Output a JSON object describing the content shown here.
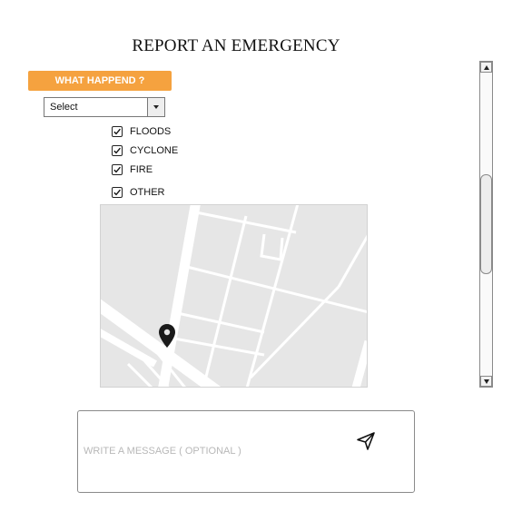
{
  "page": {
    "title": "REPORT AN EMERGENCY"
  },
  "form": {
    "what_happened_label": "WHAT HAPPEND ?",
    "select": {
      "value": "Select"
    },
    "options": [
      {
        "label": "FLOODS",
        "checked": true
      },
      {
        "label": "CYCLONE",
        "checked": true
      },
      {
        "label": "FIRE",
        "checked": true
      },
      {
        "label": "OTHER",
        "checked": true
      }
    ]
  },
  "message": {
    "placeholder": "WRITE A MESSAGE ( OPTIONAL )"
  },
  "icons": {
    "dropdown": "chevron-down-icon",
    "checkbox": "checkbox-checked-icon",
    "map_pin": "map-pin-icon",
    "send": "send-icon",
    "scroll_up": "scroll-up-arrow-icon",
    "scroll_down": "scroll-down-arrow-icon"
  },
  "colors": {
    "accent": "#f5a23f",
    "map_bg": "#e6e6e6",
    "road": "#ffffff",
    "pin": "#1a1a1a"
  }
}
